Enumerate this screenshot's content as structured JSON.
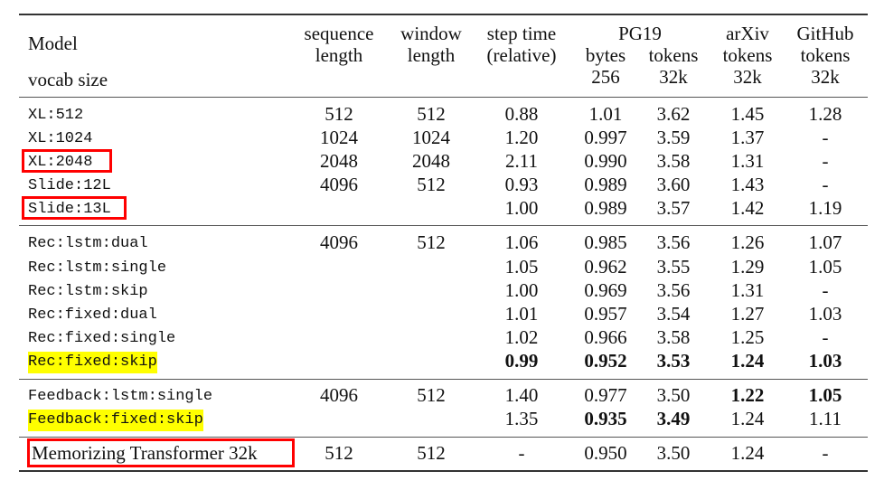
{
  "header": {
    "model": "Model",
    "vocab": "vocab size",
    "seq": [
      "sequence",
      "length"
    ],
    "win": [
      "window",
      "length"
    ],
    "step": [
      "step time",
      "(relative)"
    ],
    "pg19": "PG19",
    "pg19_bytes": [
      "bytes",
      "256"
    ],
    "pg19_tokens": [
      "tokens",
      "32k"
    ],
    "arxiv": [
      "arXiv",
      "tokens",
      "32k"
    ],
    "github": [
      "GitHub",
      "tokens",
      "32k"
    ]
  },
  "rows": [
    {
      "model": "XL:512",
      "mono": true,
      "seq": "512",
      "win": "512",
      "step": "0.88",
      "bytes": "1.01",
      "tokens": "3.62",
      "arxiv": "1.45",
      "github": "1.28"
    },
    {
      "model": "XL:1024",
      "mono": true,
      "seq": "1024",
      "win": "1024",
      "step": "1.20",
      "bytes": "0.997",
      "tokens": "3.59",
      "arxiv": "1.37",
      "github": "-"
    },
    {
      "model": "XL:2048",
      "mono": true,
      "boxed": true,
      "seq": "2048",
      "win": "2048",
      "step": "2.11",
      "bytes": "0.990",
      "tokens": "3.58",
      "arxiv": "1.31",
      "github": "-"
    },
    {
      "model": "Slide:12L",
      "mono": true,
      "seq": "4096",
      "win": "512",
      "step": "0.93",
      "bytes": "0.989",
      "tokens": "3.60",
      "arxiv": "1.43",
      "github": "-"
    },
    {
      "model": "Slide:13L",
      "mono": true,
      "boxed": true,
      "seq": "",
      "win": "",
      "step": "1.00",
      "bytes": "0.989",
      "tokens": "3.57",
      "arxiv": "1.42",
      "github": "1.19"
    },
    {
      "model": "Rec:lstm:dual",
      "mono": true,
      "seq": "4096",
      "win": "512",
      "step": "1.06",
      "bytes": "0.985",
      "tokens": "3.56",
      "arxiv": "1.26",
      "github": "1.07"
    },
    {
      "model": "Rec:lstm:single",
      "mono": true,
      "seq": "",
      "win": "",
      "step": "1.05",
      "bytes": "0.962",
      "tokens": "3.55",
      "arxiv": "1.29",
      "github": "1.05"
    },
    {
      "model": "Rec:lstm:skip",
      "mono": true,
      "seq": "",
      "win": "",
      "step": "1.00",
      "bytes": "0.969",
      "tokens": "3.56",
      "arxiv": "1.31",
      "github": "-"
    },
    {
      "model": "Rec:fixed:dual",
      "mono": true,
      "seq": "",
      "win": "",
      "step": "1.01",
      "bytes": "0.957",
      "tokens": "3.54",
      "arxiv": "1.27",
      "github": "1.03"
    },
    {
      "model": "Rec:fixed:single",
      "mono": true,
      "seq": "",
      "win": "",
      "step": "1.02",
      "bytes": "0.966",
      "tokens": "3.58",
      "arxiv": "1.25",
      "github": "-"
    },
    {
      "model": "Rec:fixed:skip",
      "mono": true,
      "highlight": true,
      "seq": "",
      "win": "",
      "step": "0.99",
      "bytes": "0.952",
      "tokens": "3.53",
      "arxiv": "1.24",
      "github": "1.03",
      "bold": [
        "step",
        "bytes",
        "tokens",
        "arxiv",
        "github"
      ]
    },
    {
      "model": "Feedback:lstm:single",
      "mono": true,
      "seq": "4096",
      "win": "512",
      "step": "1.40",
      "bytes": "0.977",
      "tokens": "3.50",
      "arxiv": "1.22",
      "github": "1.05",
      "bold": [
        "arxiv",
        "github"
      ]
    },
    {
      "model": "Feedback:fixed:skip",
      "mono": true,
      "highlight": true,
      "seq": "",
      "win": "",
      "step": "1.35",
      "bytes": "0.935",
      "tokens": "3.49",
      "arxiv": "1.24",
      "github": "1.11",
      "bold": [
        "bytes",
        "tokens"
      ]
    },
    {
      "model": "Memorizing Transformer 32k",
      "mono": false,
      "boxed": true,
      "seq": "512",
      "win": "512",
      "step": "-",
      "bytes": "0.950",
      "tokens": "3.50",
      "arxiv": "1.24",
      "github": "-"
    }
  ],
  "colors": {
    "highlight": "#ffff00",
    "box": "#ff0000"
  }
}
